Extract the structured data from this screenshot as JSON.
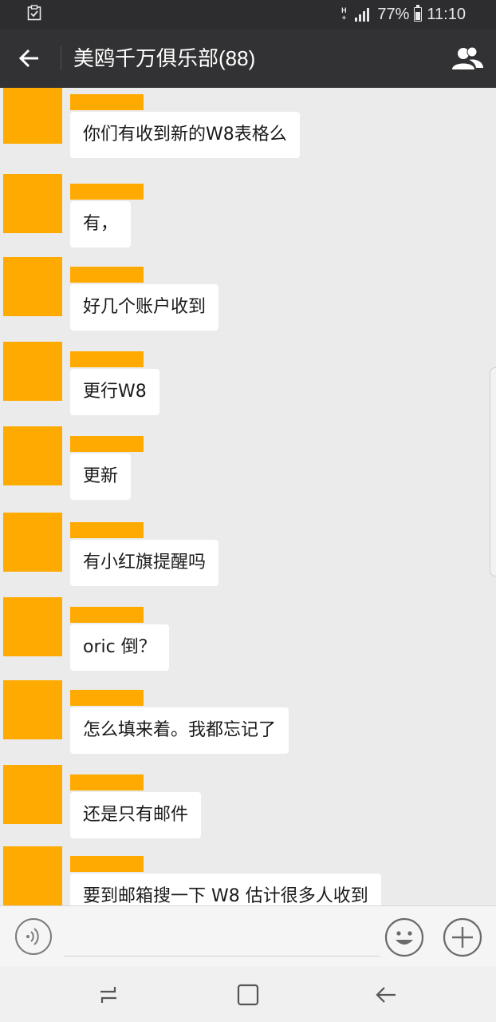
{
  "status_bar": {
    "network": "H",
    "network_sub": "+",
    "battery_percent": "77%",
    "time": "11:10",
    "battery_level": 0.77
  },
  "header": {
    "title": "美鸥千万俱乐部(88)"
  },
  "messages": [
    {
      "text": "你们有收到新的W8表格么"
    },
    {
      "text": "有，"
    },
    {
      "text": "好几个账户收到"
    },
    {
      "text": "更行W8"
    },
    {
      "text": "更新"
    },
    {
      "text": "有小红旗提醒吗"
    },
    {
      "text": "oric 倒？"
    },
    {
      "text": "怎么填来着。我都忘记了"
    },
    {
      "text": "还是只有邮件"
    },
    {
      "text": "要到邮箱搜一下 W8 估计很多人收到"
    }
  ],
  "input": {
    "value": "",
    "placeholder": ""
  },
  "colors": {
    "avatar": "#ffaa00",
    "header_bg": "#323234",
    "status_bg": "#2d2d30",
    "chat_bg": "#ebebeb",
    "bubble_bg": "#ffffff"
  },
  "icons": {
    "status_left": "checklist-icon",
    "back": "arrow-left-icon",
    "members": "people-icon",
    "voice": "voice-icon",
    "emoji": "smiley-icon",
    "plus": "plus-icon",
    "nav_recent": "recent-apps-icon",
    "nav_home": "home-icon",
    "nav_back": "nav-back-icon"
  }
}
